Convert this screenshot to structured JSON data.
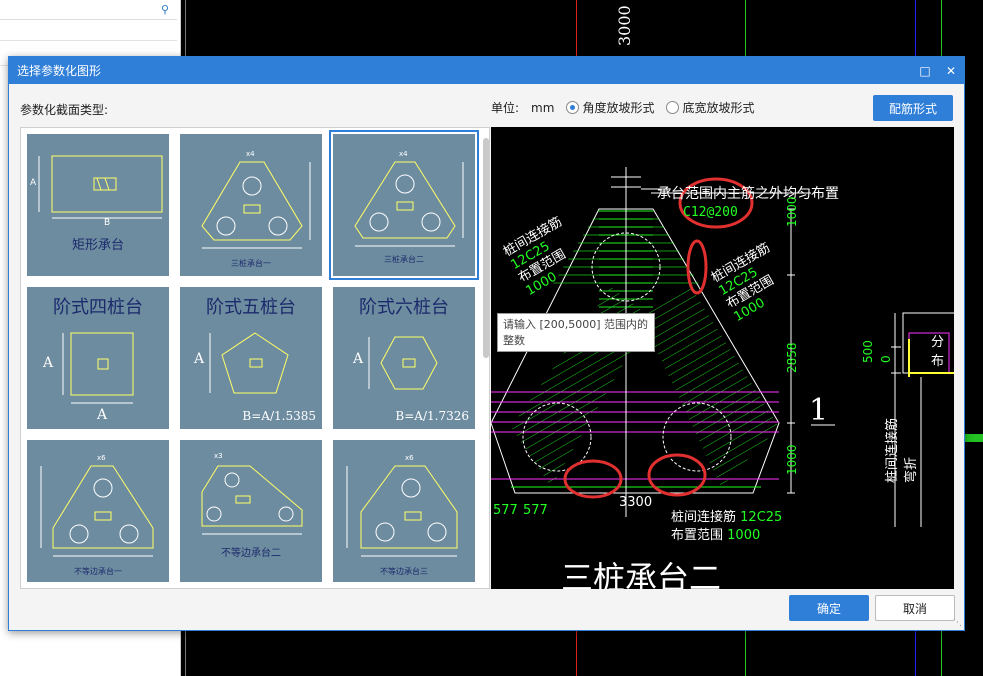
{
  "background": {
    "search_icon": "search-icon",
    "cad_dimension": "3000"
  },
  "dialog": {
    "title": "选择参数化图形",
    "maximize_icon": "maximize-icon",
    "close_icon": "close-icon",
    "section_label": "参数化截面类型:",
    "unit_label": "单位:",
    "unit_value": "mm",
    "radio_options": [
      {
        "label": "角度放坡形式",
        "selected": true
      },
      {
        "label": "底宽放坡形式",
        "selected": false
      }
    ],
    "rebar_button": "配筋形式",
    "ok_button": "确定",
    "cancel_button": "取消"
  },
  "gallery": {
    "items": [
      {
        "caption": "矩形承台",
        "labels": [
          "A",
          "B"
        ]
      },
      {
        "caption": "三桩承台一",
        "labels": [
          "x4",
          "y1",
          "y2",
          "y3",
          "x1",
          "x2",
          "x3"
        ]
      },
      {
        "caption": "三桩承台二",
        "labels": [
          "x4",
          "y1",
          "y2",
          "y3",
          "x1",
          "x2",
          "x3"
        ],
        "selected": true
      },
      {
        "caption": "阶式四桩台",
        "labels": [
          "A",
          "A"
        ]
      },
      {
        "caption": "阶式五桩台",
        "labels": [
          "A"
        ],
        "formula": "B=A/1.5385"
      },
      {
        "caption": "阶式六桩台",
        "labels": [
          "A"
        ],
        "formula": "B=A/1.7326"
      },
      {
        "caption": "不等边承台一",
        "labels": [
          "x6",
          "y1",
          "y2",
          "y3",
          "x1",
          "x2",
          "x3",
          "x4"
        ]
      },
      {
        "caption": "不等边承台二",
        "labels": [
          "x3",
          "x4",
          "y1",
          "y2",
          "y3",
          "x1",
          "x2"
        ]
      },
      {
        "caption": "不等边承台三",
        "labels": [
          "x6",
          "y1",
          "y2",
          "y3",
          "x1",
          "x2",
          "x3",
          "x4"
        ]
      }
    ]
  },
  "preview": {
    "top_note": "承台范围内主筋之外均匀布置",
    "top_rebar": "C12@200",
    "left_rebar_label": "桩间连接筋",
    "left_rebar_value": "12C25",
    "left_range_label": "布置范围",
    "left_range_value": "1000",
    "right_rebar_label": "桩间连接筋",
    "right_rebar_value": "12C25",
    "right_range_label": "布置范围",
    "right_range_value": "1000",
    "bottom_rebar_label": "桩间连接筋",
    "bottom_rebar_value": "12C25",
    "bottom_range_label": "布置范围",
    "bottom_range_value": "1000",
    "dim_top": "1000",
    "dim_mid": "2858",
    "dim_bottom": "1000",
    "dim_width": "3300",
    "dim_left1": "577",
    "dim_left2": "577",
    "dim_500": "500",
    "dim_0": "0",
    "section_mark": "1",
    "side_label": "桩间连接筋弯折",
    "side_box_text": "分布",
    "title": "三桩承台二",
    "tooltip": "请输入 [200,5000] 范围内的整数"
  },
  "colors": {
    "accent": "#2f7ed8",
    "thumb_bg": "#6e8ca0",
    "cad_green": "#22ff22",
    "cad_magenta": "#ff33ff",
    "cad_red": "#e03030"
  }
}
